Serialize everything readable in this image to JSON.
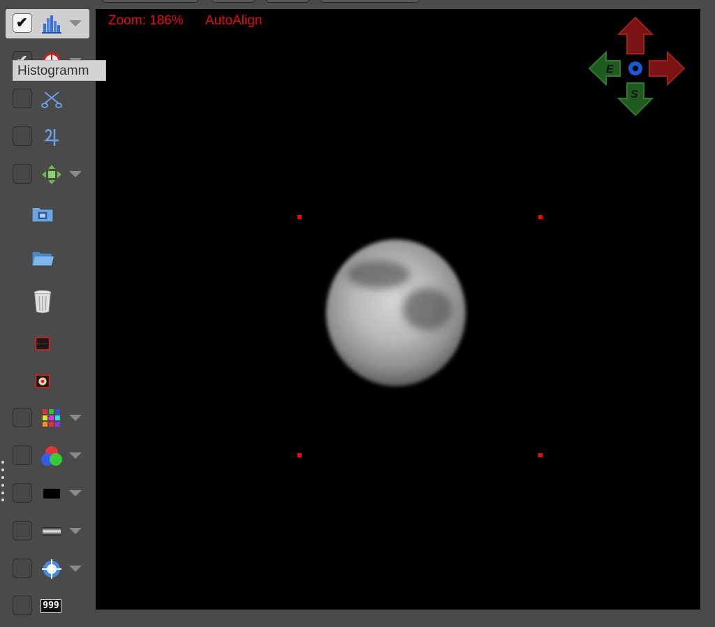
{
  "window": {
    "title": ""
  },
  "overlay": {
    "zoom_text": "Zoom: 186%",
    "align_text": "AutoAlign"
  },
  "tooltip": {
    "text": "Histogramm"
  },
  "compass": {
    "east_label": "E",
    "south_label": "S"
  },
  "toolbar": {
    "items": [
      {
        "name": "histogram",
        "icon": "histogram-icon",
        "checked": true,
        "has_dropdown": true
      },
      {
        "name": "crosshair",
        "icon": "crosshair-icon",
        "checked": true,
        "has_dropdown": true
      },
      {
        "name": "cut",
        "icon": "scissors-icon",
        "checked": false,
        "has_dropdown": false
      },
      {
        "name": "jupiter",
        "icon": "jupiter-symbol-icon",
        "checked": false,
        "has_dropdown": false
      },
      {
        "name": "move",
        "icon": "move-arrows-icon",
        "checked": false,
        "has_dropdown": true
      },
      {
        "name": "video",
        "icon": "film-folder-icon"
      },
      {
        "name": "open",
        "icon": "open-folder-icon"
      },
      {
        "name": "trash",
        "icon": "trash-icon"
      },
      {
        "name": "roi",
        "icon": "roi-frame-icon"
      },
      {
        "name": "target",
        "icon": "planet-target-icon"
      },
      {
        "name": "grid",
        "icon": "color-grid-icon",
        "checked": false,
        "has_dropdown": true
      },
      {
        "name": "rgb",
        "icon": "rgb-circles-icon",
        "checked": false,
        "has_dropdown": true
      },
      {
        "name": "black",
        "icon": "black-rectangle-icon",
        "checked": false,
        "has_dropdown": true
      },
      {
        "name": "gradient",
        "icon": "gradient-bar-icon",
        "checked": false,
        "has_dropdown": true
      },
      {
        "name": "reticle",
        "icon": "reticle-icon",
        "checked": false,
        "has_dropdown": true
      },
      {
        "name": "counter",
        "icon": "counter-999-icon",
        "checked": false,
        "counter_text": "999"
      }
    ]
  },
  "colors": {
    "overlay_red": "#e01010",
    "marker_red": "#ff0000",
    "panel": "#4a4a4a",
    "selected": "#cfcfcf"
  }
}
